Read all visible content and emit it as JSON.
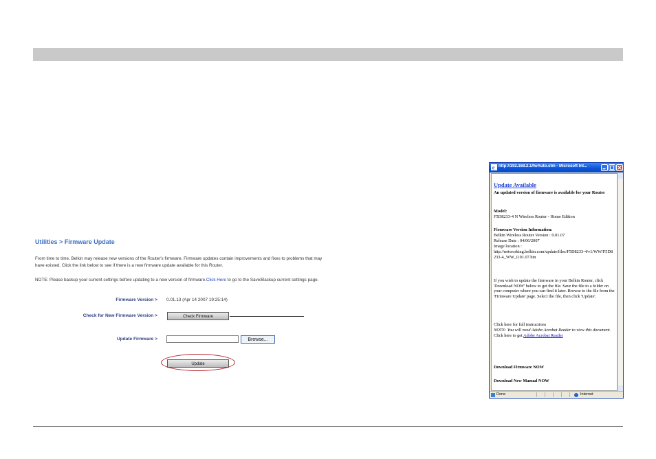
{
  "router": {
    "breadcrumb": "Utilities > Firmware Update",
    "intro": "From time to time, Belkin may release new versions of the Router's firmware. Firmware updates contain improvements and fixes to problems that may have existed. Click the link below to see if there is a new firmware update available for this Router.",
    "note_prefix": "NOTE: Please backup your current settings before updating to a new version of firmware.",
    "note_link": "Click Here",
    "note_suffix": " to go to the Save/Backup current settings page.",
    "firmware_version_label": "Firmware Version >",
    "firmware_version_value": "0.01.13 (Apr 14 2007 19:25:14)",
    "check_label": "Check for New Firmware Version >",
    "check_button": "Check Firmware",
    "update_label": "Update Firmware >",
    "browse_button": "Browse...",
    "update_button": "Update"
  },
  "popup": {
    "window_title": "http://192.168.2.1/fwAuto.stm - Microsoft Int...",
    "update_available": "Update Available",
    "update_msg": "An updated version of firmware is available for your Router",
    "model_label": "Model:",
    "model_value": "F5D8233-4 N Wireless Router - Home Edition",
    "fw_info_label": "Firmware Version Information:",
    "fw_version_line": "Belkin Wireless Router Version : 0.01.07",
    "release_date_line": "Release Date : 04/06/2007",
    "image_location_label": "Image location :",
    "image_location_url": "http://networking.belkin.com/update/files/F5D8233-4/v1/WW/F5D8233-4_WW_0.01.07.bin",
    "instructions": "If you wish to update the firmware in your Belkin Router, click 'Download NOW' below to get the file. Save the file to a folder on your computer where you can find it later. Browse to the file from the 'Firmware Update' page. Select the file, then click 'Update'.",
    "full_instructions_link": "Click here for full instructions",
    "note_text": "NOTE: You will need Adobe Acrobat Reader to view this document.",
    "note_get": " Click here to get ",
    "acrobat_link": "Adobe Acrobat Reader",
    "download_firmware": "Download Firmware NOW",
    "download_manual": "Download New Manual NOW",
    "status_done": "Done",
    "status_zone": "Internet"
  }
}
